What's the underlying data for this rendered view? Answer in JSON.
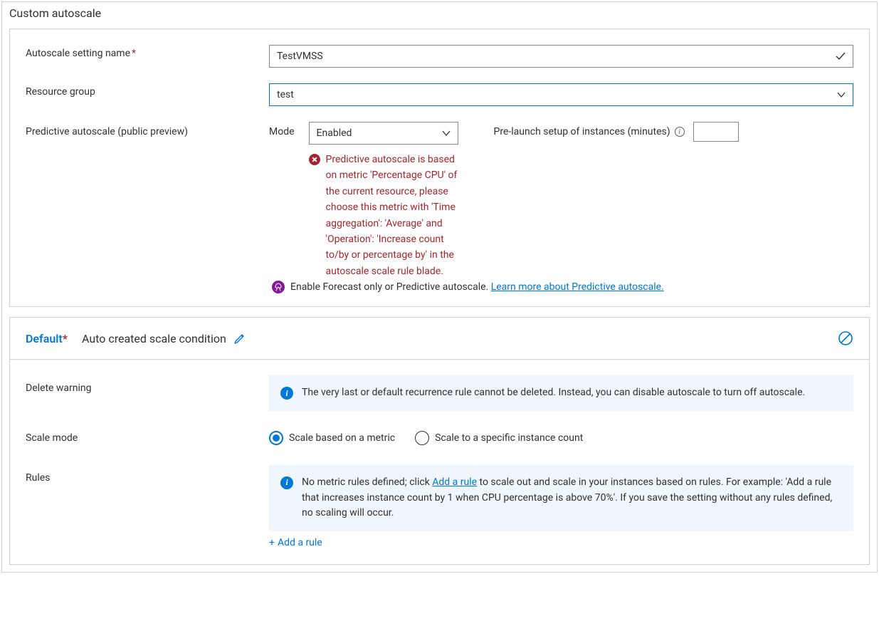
{
  "main_title": "Custom autoscale",
  "settings": {
    "name_label": "Autoscale setting name",
    "name_value": "TestVMSS",
    "rg_label": "Resource group",
    "rg_value": "test",
    "predictive_label": "Predictive autoscale (public preview)",
    "mode_label": "Mode",
    "mode_value": "Enabled",
    "mode_error": "Predictive autoscale is based on metric 'Percentage CPU' of the current resource, please choose this metric with 'Time aggregation': 'Average' and 'Operation': 'Increase count to/by or percentage by' in the autoscale scale rule blade.",
    "prelaunch_label": "Pre-launch setup of instances (minutes)",
    "prelaunch_value": "",
    "forecast_text": "Enable Forecast only or Predictive autoscale. ",
    "forecast_link": "Learn more about Predictive autoscale."
  },
  "condition": {
    "header_title": "Default",
    "header_subtitle": "Auto created scale condition",
    "delete_label": "Delete warning",
    "delete_text": "The very last or default recurrence rule cannot be deleted. Instead, you can disable autoscale to turn off autoscale.",
    "scale_mode_label": "Scale mode",
    "scale_opt_metric": "Scale based on a metric",
    "scale_opt_count": "Scale to a specific instance count",
    "rules_label": "Rules",
    "rules_text_before": "No metric rules defined; click ",
    "rules_text_link": "Add a rule",
    "rules_text_after": " to scale out and scale in your instances based on rules. For example: 'Add a rule that increases instance count by 1 when CPU percentage is above 70%'. If you save the setting without any rules defined, no scaling will occur.",
    "add_rule_label": "Add a rule"
  }
}
